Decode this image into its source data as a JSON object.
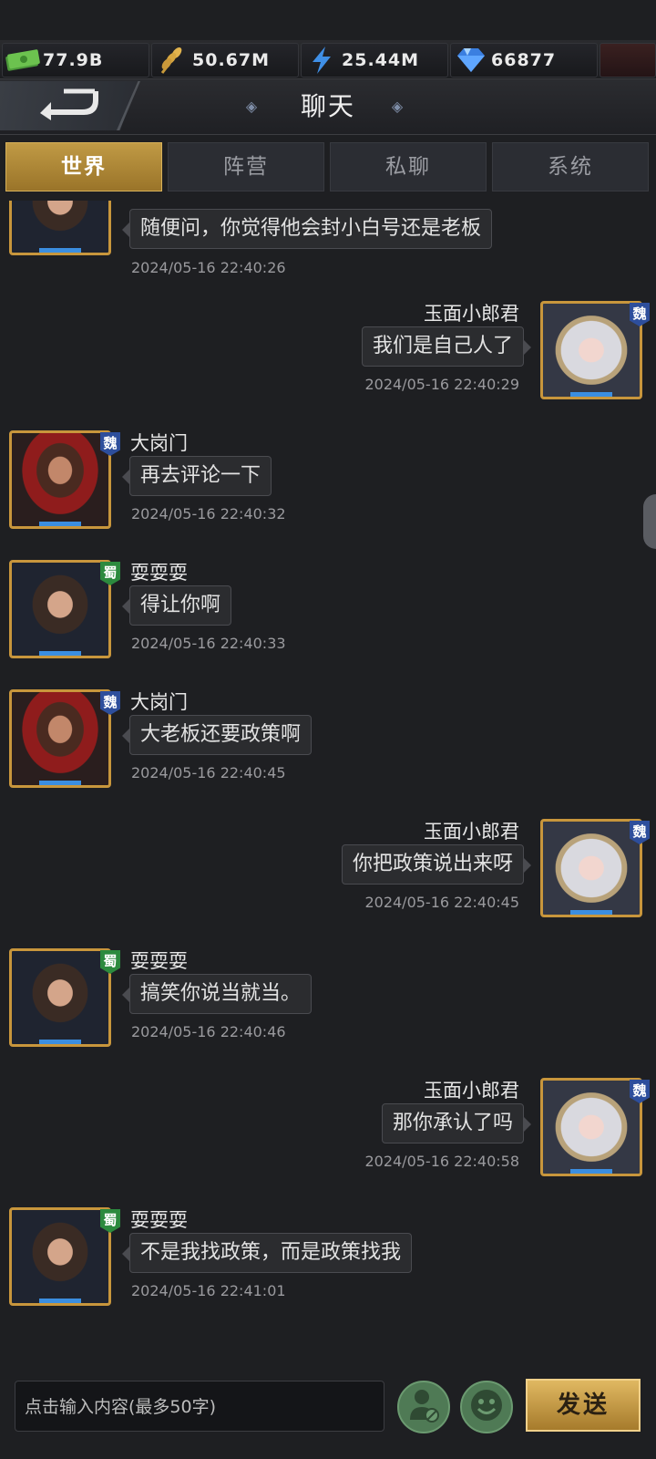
{
  "resources": [
    {
      "icon": "money-icon",
      "value": "77.9B"
    },
    {
      "icon": "wheat-icon",
      "value": "50.67M"
    },
    {
      "icon": "lightning-icon",
      "value": "25.44M"
    },
    {
      "icon": "diamond-icon",
      "value": "66877"
    }
  ],
  "header": {
    "title": "聊天",
    "back_icon": "back-arrow-icon"
  },
  "tabs": [
    {
      "label": "世界",
      "active": true
    },
    {
      "label": "阵营",
      "active": false
    },
    {
      "label": "私聊",
      "active": false
    },
    {
      "label": "系统",
      "active": false
    }
  ],
  "messages": [
    {
      "side": "left",
      "name": "",
      "faction": "",
      "text": "随便问，你觉得他会封小白号还是老板",
      "time": "2024/05-16 22:40:26",
      "avatar": "male-long-hair"
    },
    {
      "side": "right",
      "name": "玉面小郎君",
      "faction": "魏",
      "text": "我们是自己人了",
      "time": "2024/05-16 22:40:29",
      "avatar": "female-white-hair"
    },
    {
      "side": "left",
      "name": "大岗门",
      "faction": "魏",
      "text": "再去评论一下",
      "time": "2024/05-16 22:40:32",
      "avatar": "male-red-armor"
    },
    {
      "side": "left",
      "name": "耍耍耍",
      "faction": "蜀",
      "text": "得让你啊",
      "time": "2024/05-16 22:40:33",
      "avatar": "male-long-hair"
    },
    {
      "side": "left",
      "name": "大岗门",
      "faction": "魏",
      "text": "大老板还要政策啊",
      "time": "2024/05-16 22:40:45",
      "avatar": "male-red-armor"
    },
    {
      "side": "right",
      "name": "玉面小郎君",
      "faction": "魏",
      "text": "你把政策说出来呀",
      "time": "2024/05-16 22:40:45",
      "avatar": "female-white-hair"
    },
    {
      "side": "left",
      "name": "耍耍耍",
      "faction": "蜀",
      "text": "搞笑你说当就当。",
      "time": "2024/05-16 22:40:46",
      "avatar": "male-long-hair"
    },
    {
      "side": "right",
      "name": "玉面小郎君",
      "faction": "魏",
      "text": "那你承认了吗",
      "time": "2024/05-16 22:40:58",
      "avatar": "female-white-hair"
    },
    {
      "side": "left",
      "name": "耍耍耍",
      "faction": "蜀",
      "text": "不是我找政策，而是政策找我",
      "time": "2024/05-16 22:41:01",
      "avatar": "male-long-hair"
    }
  ],
  "input": {
    "placeholder": "点击输入内容(最多50字)"
  },
  "buttons": {
    "block_icon": "block-user-icon",
    "emoji_icon": "emoji-icon",
    "send_label": "发送"
  }
}
